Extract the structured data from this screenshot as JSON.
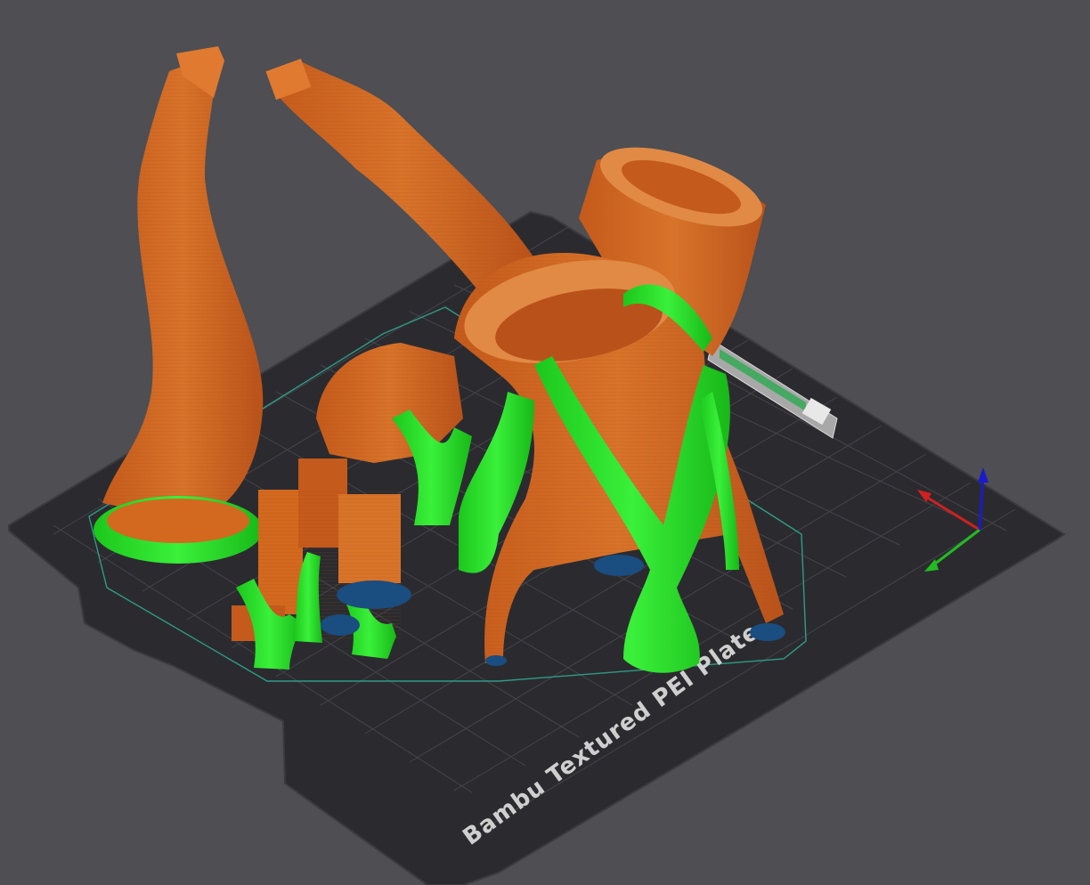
{
  "plate": {
    "label": "Bambu Textured PEI Plate"
  },
  "colors": {
    "background": "#4e4e53",
    "plate": "#2b2b2f",
    "grid": "#4a4a50",
    "model": "#d2691e",
    "support": "#22dd22",
    "brim": "#1a4d80"
  },
  "axes": {
    "x_color": "#d02020",
    "y_color": "#22bb22",
    "z_color": "#1a1acc"
  },
  "icons": {
    "axis_gizmo": "xyz-axes-icon",
    "wipe_tower": "prime-tower"
  }
}
